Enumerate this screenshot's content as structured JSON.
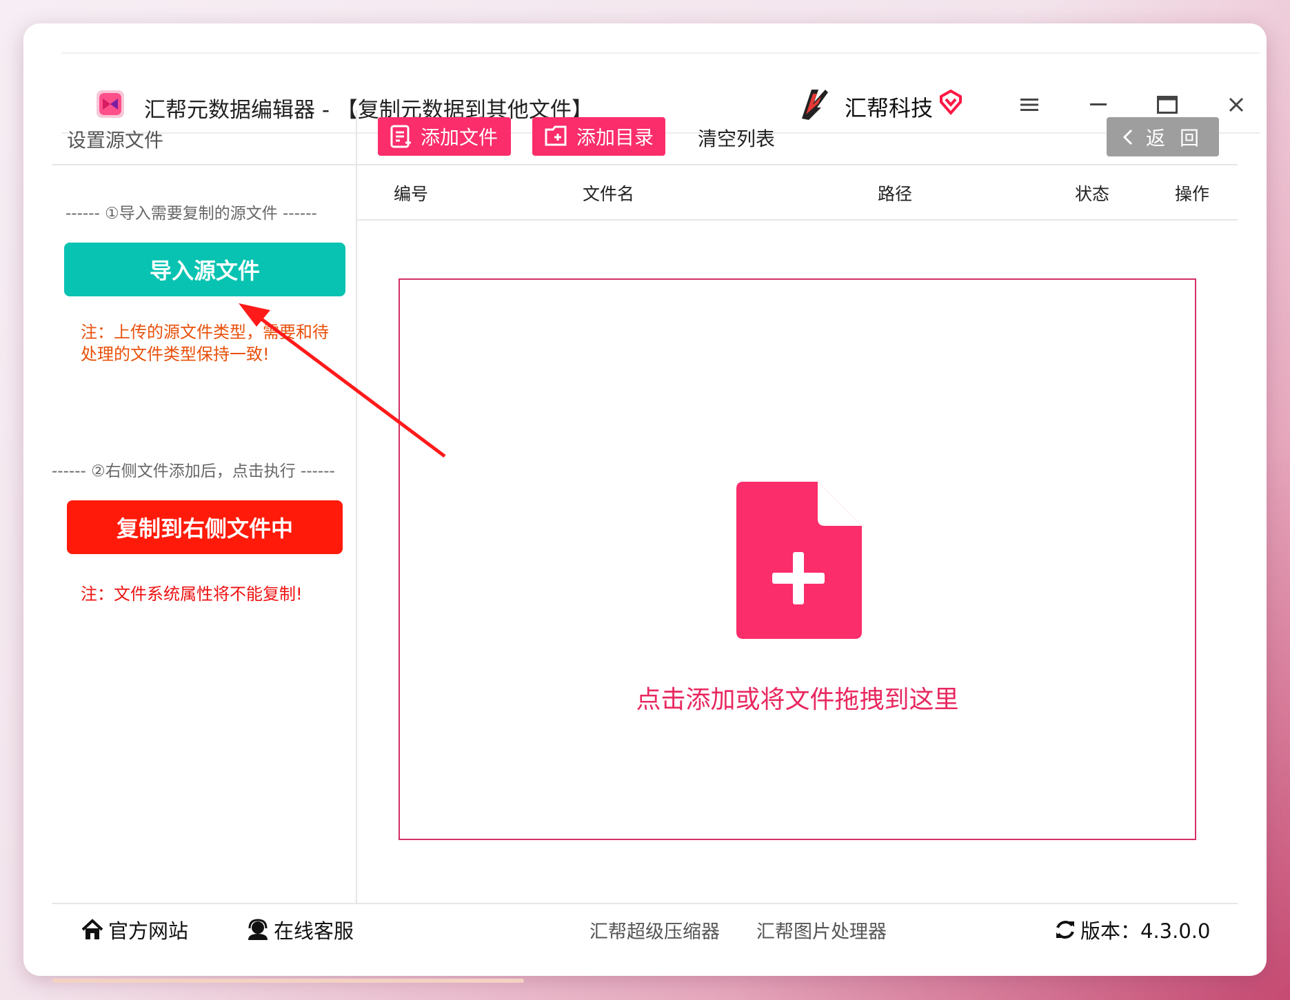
{
  "window": {
    "title": "汇帮元数据编辑器 - 【复制元数据到其他文件】",
    "brand": "汇帮科技"
  },
  "sidebar": {
    "title": "设置源文件",
    "step1": "------ ①导入需要复制的源文件 ------",
    "import_button": "导入源文件",
    "note1": "注：上传的源文件类型，需要和待处理的文件类型保持一致!",
    "step2": "------ ②右侧文件添加后，点击执行 ------",
    "copy_button": "复制到右侧文件中",
    "note2": "注：文件系统属性将不能复制!"
  },
  "toolbar": {
    "add_file": "添加文件",
    "add_dir": "添加目录",
    "clear": "清空列表",
    "back": "返 回"
  },
  "table": {
    "columns": [
      "编号",
      "文件名",
      "路径",
      "状态",
      "操作"
    ]
  },
  "dropzone": {
    "text": "点击添加或将文件拖拽到这里"
  },
  "footer": {
    "website": "官方网站",
    "support": "在线客服",
    "link1": "汇帮超级压缩器",
    "link2": "汇帮图片处理器",
    "version": "版本：4.3.0.0"
  },
  "colors": {
    "accent_pink": "#fb2d6b",
    "teal": "#08c3b1",
    "red": "#ff1a0a",
    "dropzone_border": "#d32f63"
  }
}
